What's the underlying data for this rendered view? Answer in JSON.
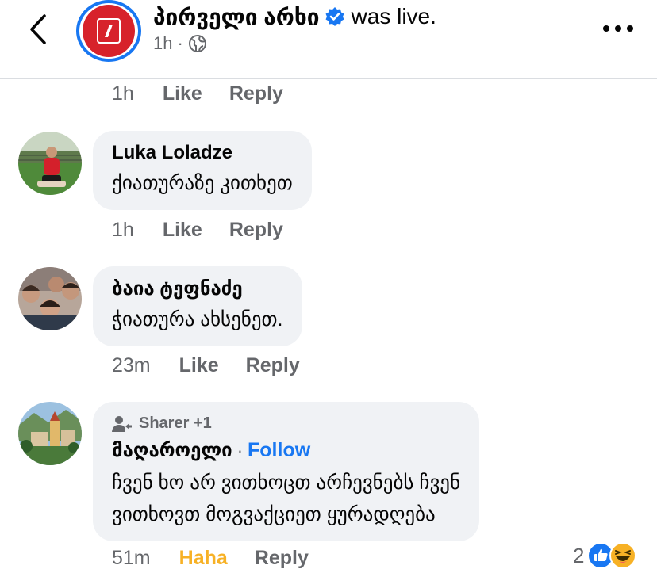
{
  "header": {
    "page_name": "პირველი არხი",
    "status_text": "was live.",
    "time": "1h",
    "separator": "·",
    "icons": {
      "back": "chevron-left-icon",
      "verified": "verified-badge-icon",
      "audience": "globe-icon",
      "more": "more-options-icon"
    },
    "colors": {
      "brand_red": "#d7222b",
      "facebook_blue": "#1877f2"
    }
  },
  "top_actions": {
    "time": "1h",
    "like": "Like",
    "reply": "Reply"
  },
  "comments": [
    {
      "author": "Luka Loladze",
      "text": "ქიათურაზე კითხეთ",
      "time": "1h",
      "like": "Like",
      "reply": "Reply"
    },
    {
      "author": "ბაია ტეფნაძე",
      "text": "ჭიათურა ახსენეთ.",
      "time": "23m",
      "like": "Like",
      "reply": "Reply"
    },
    {
      "badge": "Sharer +1",
      "author": "მაღაროელი",
      "separator": "·",
      "follow": "Follow",
      "text_lines": [
        "ჩვენ ხო არ ვითხოცთ არჩევნებს ჩვენ",
        "ვითხოვთ მოგვაქციეთ ყურადღება"
      ],
      "time": "51m",
      "reaction_label": "Haha",
      "reply": "Reply",
      "reaction_count": "2",
      "reaction_icons": [
        "like-reaction-icon",
        "haha-reaction-icon"
      ]
    }
  ]
}
